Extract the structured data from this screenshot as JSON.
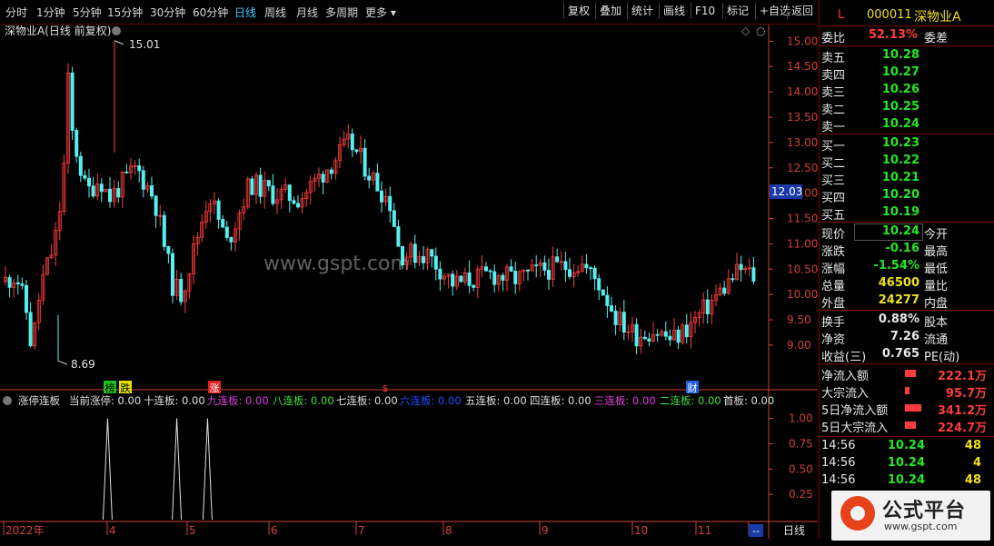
{
  "toolbar": {
    "periods": [
      "分时",
      "1分钟",
      "5分钟",
      "15分钟",
      "30分钟",
      "60分钟",
      "日线",
      "周线",
      "月线",
      "多周期",
      "更多"
    ],
    "selected": "日线",
    "right_buttons": [
      "复权",
      "叠加",
      "统计",
      "画线",
      "F10",
      "标记",
      "+自选",
      "返回"
    ]
  },
  "main_chart": {
    "title": "深物业A(日线 前复权)",
    "high_label": "15.01",
    "low_label": "8.69",
    "current_price_tag": "12.03",
    "watermark": "www.gspt.com",
    "markers": [
      "榜",
      "跌",
      "涨",
      "$",
      "财"
    ],
    "price_axis": [
      "15.00",
      "14.50",
      "14.00",
      "13.50",
      "13.00",
      "12.50",
      "12.00",
      "11.50",
      "11.00",
      "10.50",
      "10.00",
      "9.50",
      "9.00"
    ]
  },
  "indicator": {
    "legend": [
      {
        "label": "涨停连板",
        "value": "",
        "color": "#e0e0e0"
      },
      {
        "label": "当前涨停",
        "value": "0.00",
        "color": "#e0e0e0"
      },
      {
        "label": "十连板",
        "value": "0.00",
        "color": "#e0e0e0"
      },
      {
        "label": "九连板",
        "value": "0.00",
        "color": "#e040e0"
      },
      {
        "label": "八连板",
        "value": "0.00",
        "color": "#40e040"
      },
      {
        "label": "七连板",
        "value": "0.00",
        "color": "#e0e0e0"
      },
      {
        "label": "六连板",
        "value": "0.00",
        "color": "#2050ff"
      },
      {
        "label": "五连板",
        "value": "0.00",
        "color": "#e0e0e0"
      },
      {
        "label": "四连板",
        "value": "0.00",
        "color": "#e0e0e0"
      },
      {
        "label": "三连板",
        "value": "0.00",
        "color": "#e040e0"
      },
      {
        "label": "二连板",
        "value": "0.00",
        "color": "#40e040"
      },
      {
        "label": "首板",
        "value": "0.00",
        "color": "#e0e0e0"
      }
    ],
    "axis": [
      "1.00",
      "0.75",
      "0.50",
      "0.25"
    ],
    "spikes": [
      0.14,
      0.23,
      0.27
    ]
  },
  "x_axis": {
    "labels": [
      "2022年",
      "4",
      "5",
      "6",
      "7",
      "8",
      "9",
      "10",
      "11",
      "--"
    ],
    "period_label": "日线"
  },
  "quote": {
    "code_prefix": "L",
    "code": "000011",
    "name": "深物业A",
    "wei_bi_label": "委比",
    "wei_bi": "52.13%",
    "wei_cha_label": "委差",
    "asks": [
      {
        "label": "卖五",
        "price": "10.28"
      },
      {
        "label": "卖四",
        "price": "10.27"
      },
      {
        "label": "卖三",
        "price": "10.26"
      },
      {
        "label": "卖二",
        "price": "10.25"
      },
      {
        "label": "卖一",
        "price": "10.24"
      }
    ],
    "bids": [
      {
        "label": "买一",
        "price": "10.23"
      },
      {
        "label": "买二",
        "price": "10.22"
      },
      {
        "label": "买三",
        "price": "10.21"
      },
      {
        "label": "买四",
        "price": "10.20"
      },
      {
        "label": "买五",
        "price": "10.19"
      }
    ],
    "stats": [
      {
        "label": "现价",
        "value": "10.24",
        "label2": "今开",
        "color": "green",
        "box": true
      },
      {
        "label": "涨跌",
        "value": "-0.16",
        "label2": "最高",
        "color": "green"
      },
      {
        "label": "涨幅",
        "value": "-1.54%",
        "label2": "最低",
        "color": "green"
      },
      {
        "label": "总量",
        "value": "46500",
        "label2": "量比",
        "color": "yellow"
      },
      {
        "label": "外盘",
        "value": "24277",
        "label2": "内盘",
        "color": "yellow"
      }
    ],
    "fund": [
      {
        "label": "换手",
        "value": "0.88%",
        "label2": "股本"
      },
      {
        "label": "净资",
        "value": "7.26",
        "label2": "流通"
      },
      {
        "label": "收益(三)",
        "value": "0.765",
        "label2": "PE(动)"
      }
    ],
    "flows": [
      {
        "label": "净流入额",
        "value": "222.1万",
        "bar": 0.3
      },
      {
        "label": "大宗流入",
        "value": "95.7万",
        "bar": 0.12
      },
      {
        "label": "5日净流入额",
        "value": "341.2万",
        "bar": 0.46
      },
      {
        "label": "5日大宗流入",
        "value": "224.7万",
        "bar": 0.3
      }
    ],
    "ticks": [
      {
        "time": "14:56",
        "price": "10.24",
        "vol": "48"
      },
      {
        "time": "14:56",
        "price": "10.24",
        "vol": "4"
      },
      {
        "time": "14:56",
        "price": "10.24",
        "vol": "48"
      }
    ]
  },
  "logo": {
    "title": "公式平台",
    "url": "www.gspt.com"
  },
  "colors": {
    "up": "#ff3b3b",
    "down": "#54f0f0",
    "grid": "#5a0000",
    "axis": "#d0403a"
  }
}
